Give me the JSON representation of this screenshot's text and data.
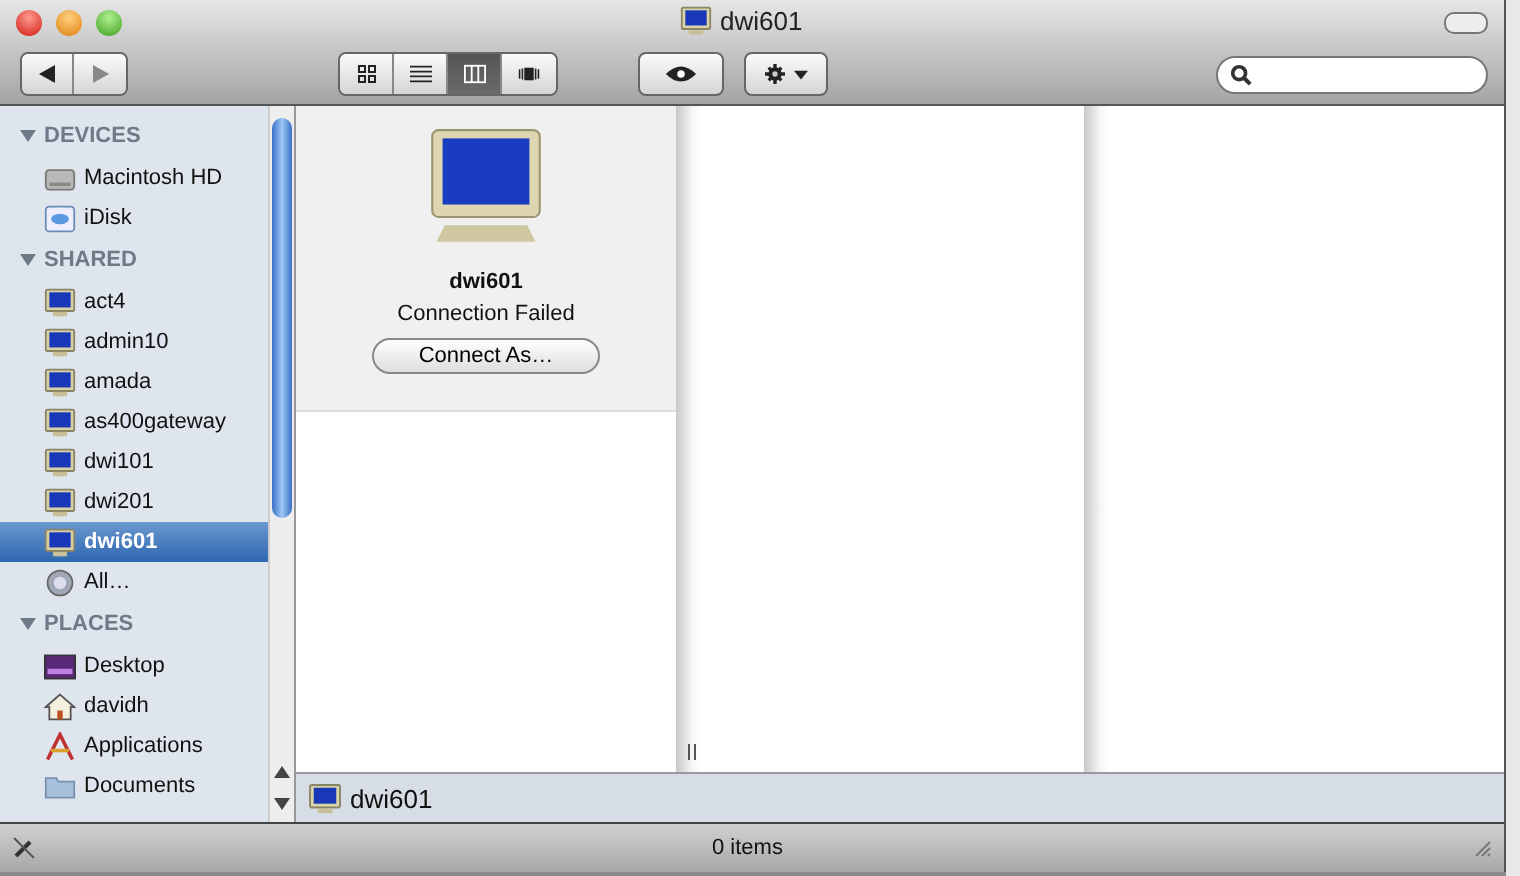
{
  "window": {
    "title": "dwi601"
  },
  "toolbar": {
    "view_buttons": [
      {
        "kind": "icons",
        "selected": false
      },
      {
        "kind": "list",
        "selected": false
      },
      {
        "kind": "columns",
        "selected": true
      },
      {
        "kind": "coverflow",
        "selected": false
      }
    ]
  },
  "sidebar": {
    "sections": [
      {
        "title": "DEVICES",
        "expanded": true,
        "items": [
          {
            "label": "Macintosh HD",
            "kind": "disk",
            "selected": false
          },
          {
            "label": "iDisk",
            "kind": "idisk",
            "selected": false
          }
        ]
      },
      {
        "title": "SHARED",
        "expanded": true,
        "items": [
          {
            "label": "act4",
            "kind": "computer",
            "selected": false
          },
          {
            "label": "admin10",
            "kind": "computer",
            "selected": false
          },
          {
            "label": "amada",
            "kind": "computer",
            "selected": false
          },
          {
            "label": "as400gateway",
            "kind": "computer",
            "selected": false
          },
          {
            "label": "dwi101",
            "kind": "computer",
            "selected": false
          },
          {
            "label": "dwi201",
            "kind": "computer",
            "selected": false
          },
          {
            "label": "dwi601",
            "kind": "computer",
            "selected": true
          },
          {
            "label": "All…",
            "kind": "globe",
            "selected": false
          }
        ]
      },
      {
        "title": "PLACES",
        "expanded": true,
        "items": [
          {
            "label": "Desktop",
            "kind": "desktop",
            "selected": false
          },
          {
            "label": "davidh",
            "kind": "home",
            "selected": false
          },
          {
            "label": "Applications",
            "kind": "apps",
            "selected": false
          },
          {
            "label": "Documents",
            "kind": "docs",
            "selected": false
          }
        ]
      }
    ]
  },
  "preview": {
    "name": "dwi601",
    "status": "Connection Failed",
    "button": "Connect As…"
  },
  "path_bar": {
    "label": "dwi601"
  },
  "status_bar": {
    "text": "0 items"
  }
}
